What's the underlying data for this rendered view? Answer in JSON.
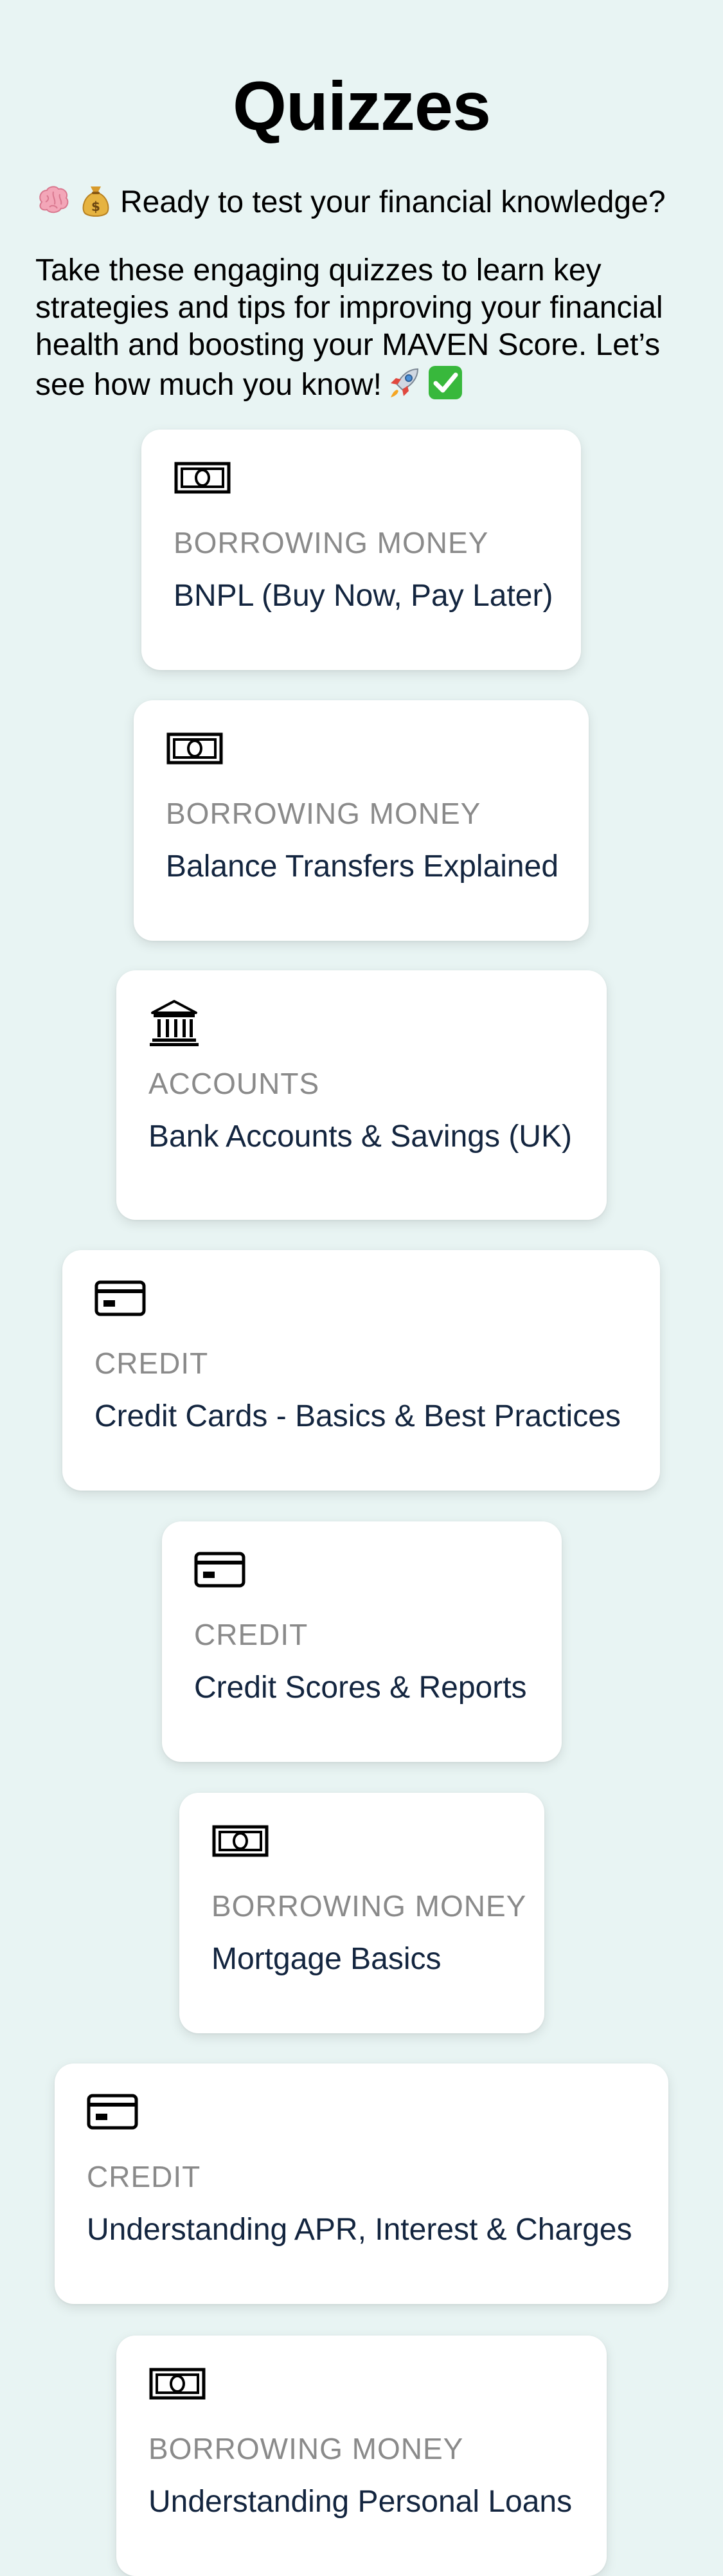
{
  "page": {
    "title": "Quizzes",
    "tagline": "Ready to test your financial knowledge?",
    "tagline_icons": [
      "brain-emoji",
      "money-bag-emoji"
    ],
    "intro": "Take these engaging quizzes to learn key strategies and tips for improving your financial health and boosting your MAVEN Score. Let’s see how much you know!",
    "intro_icons": [
      "rocket-emoji",
      "check-mark-emoji"
    ]
  },
  "quizzes": [
    {
      "category": "BORROWING MONEY",
      "name": "BNPL (Buy Now, Pay Later)",
      "icon": "banknote-icon"
    },
    {
      "category": "BORROWING MONEY",
      "name": "Balance Transfers Explained",
      "icon": "banknote-icon"
    },
    {
      "category": "ACCOUNTS",
      "name": "Bank Accounts & Savings (UK)",
      "icon": "bank-icon"
    },
    {
      "category": "CREDIT",
      "name": "Credit Cards - Basics & Best Practices",
      "icon": "credit-card-icon"
    },
    {
      "category": "CREDIT",
      "name": "Credit Scores & Reports",
      "icon": "credit-card-icon"
    },
    {
      "category": "BORROWING MONEY",
      "name": "Mortgage Basics",
      "icon": "banknote-icon"
    },
    {
      "category": "CREDIT",
      "name": "Understanding APR, Interest & Charges",
      "icon": "credit-card-icon"
    },
    {
      "category": "BORROWING MONEY",
      "name": "Understanding Personal Loans",
      "icon": "banknote-icon"
    }
  ]
}
